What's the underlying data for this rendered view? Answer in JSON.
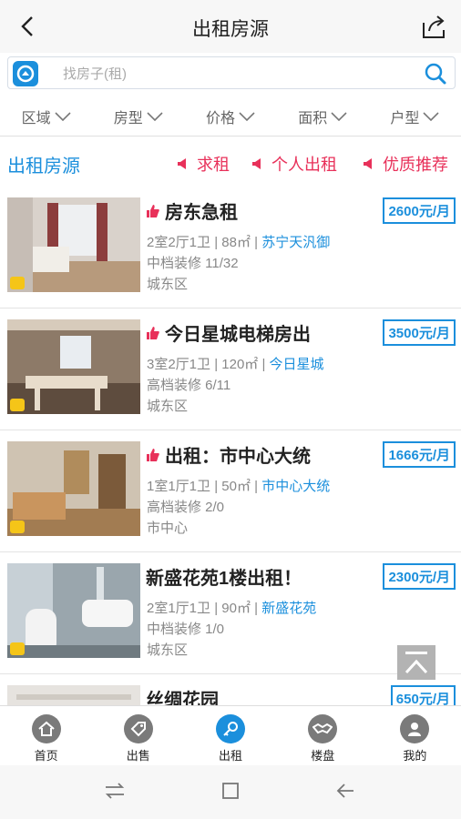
{
  "header": {
    "title": "出租房源"
  },
  "search": {
    "placeholder": "找房子(租)"
  },
  "filters": [
    "区域",
    "房型",
    "价格",
    "面积",
    "户型"
  ],
  "section": {
    "title": "出租房源",
    "links": [
      "求租",
      "个人出租",
      "优质推荐"
    ]
  },
  "listings": [
    {
      "title": "房东急租",
      "hot": true,
      "price": "2600元/月",
      "spec": "2室2厅1卫 | 88㎡ | ",
      "community": "苏宁天汎御",
      "deco": "中档装修 11/32",
      "area": "城东区"
    },
    {
      "title": "今日星城电梯房出",
      "hot": true,
      "price": "3500元/月",
      "spec": "3室2厅1卫 | 120㎡ | ",
      "community": "今日星城",
      "deco": "高档装修 6/11",
      "area": "城东区"
    },
    {
      "title": "出租：市中心大统",
      "hot": true,
      "price": "1666元/月",
      "spec": "1室1厅1卫 | 50㎡ | ",
      "community": "市中心大统",
      "deco": "高档装修 2/0",
      "area": "市中心"
    },
    {
      "title": "新盛花苑1楼出租！",
      "hot": false,
      "price": "2300元/月",
      "spec": "2室1厅1卫 | 90㎡ | ",
      "community": "新盛花苑",
      "deco": "中档装修 1/0",
      "area": "城东区"
    },
    {
      "title": "丝绸花园",
      "hot": false,
      "price": "650元/月",
      "spec": "",
      "community": "",
      "deco": "",
      "area": ""
    }
  ],
  "tabbar": [
    {
      "label": "首页",
      "icon": "home-icon"
    },
    {
      "label": "出售",
      "icon": "tag-icon"
    },
    {
      "label": "出租",
      "icon": "key-icon",
      "active": true
    },
    {
      "label": "楼盘",
      "icon": "handshake-icon"
    },
    {
      "label": "我的",
      "icon": "user-icon"
    }
  ],
  "colors": {
    "accent": "#1b8fdc",
    "red": "#e8315a"
  }
}
